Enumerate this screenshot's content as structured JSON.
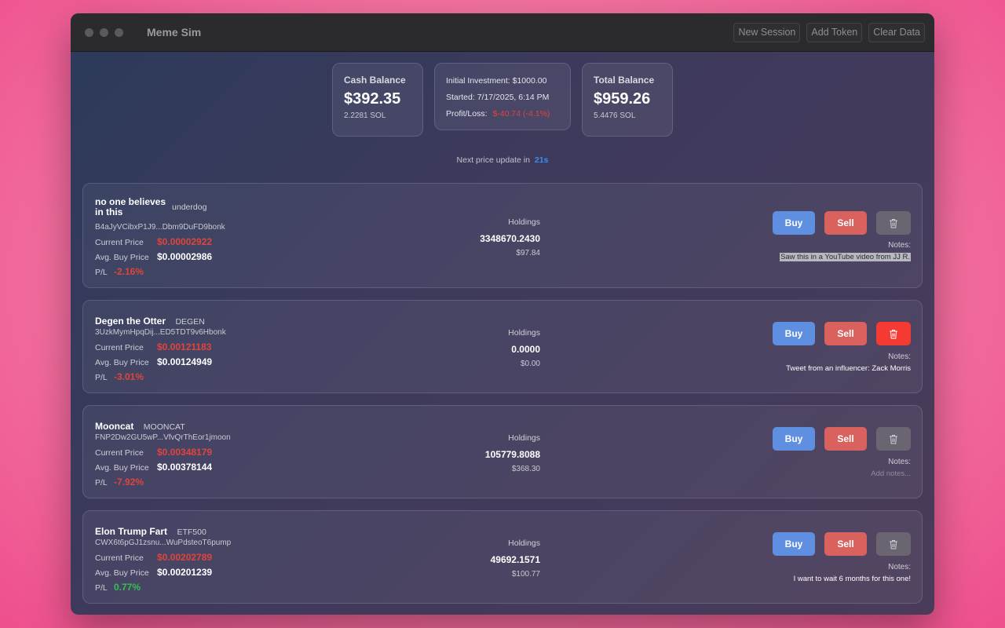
{
  "window": {
    "title": "Meme Sim",
    "toolbar": {
      "new_session": "New Session",
      "add_token": "Add Token",
      "clear_data": "Clear Data"
    }
  },
  "summary": {
    "cash": {
      "label": "Cash Balance",
      "value": "$392.35",
      "sol": "2.2281 SOL"
    },
    "info": {
      "initial_label": "Initial Investment:",
      "initial_value": "$1000.00",
      "started_label": "Started:",
      "started_value": "7/17/2025, 6:14 PM",
      "pl_label": "Profit/Loss:",
      "pl_value": "$-40.74 (-4.1%)"
    },
    "total": {
      "label": "Total Balance",
      "value": "$959.26",
      "sol": "5.4476 SOL"
    }
  },
  "countdown": {
    "label": "Next price update in",
    "value": "21s"
  },
  "labels": {
    "current_price": "Current Price",
    "avg_buy_price": "Avg. Buy Price",
    "pl": "P/L",
    "holdings": "Holdings",
    "notes": "Notes:",
    "buy": "Buy",
    "sell": "Sell"
  },
  "tokens": [
    {
      "name": "no one believes in this",
      "name_line1": "no one believes",
      "name_line2": "in this",
      "symbol": "underdog",
      "address": "B4aJyVCibxP1J9...Dbm9DuFD9bonk",
      "current_price": "$0.00002922",
      "avg_buy_price": "$0.00002986",
      "pl": "-2.16%",
      "holdings_amount": "3348670.2430",
      "holdings_usd": "$97.84",
      "notes": "Saw this in a YouTube video from JJ R."
    },
    {
      "name": "Degen the Otter",
      "symbol": "DEGEN",
      "address": "3UzkMymHpqDij...ED5TDT9v6Hbonk",
      "current_price": "$0.00121183",
      "avg_buy_price": "$0.00124949",
      "pl": "-3.01%",
      "holdings_amount": "0.0000",
      "holdings_usd": "$0.00",
      "notes": "Tweet from an influencer: Zack Morris"
    },
    {
      "name": "Mooncat",
      "symbol": "MOONCAT",
      "address": "FNP2Dw2GU5wP...VfvQrThEor1jmoon",
      "current_price": "$0.00348179",
      "avg_buy_price": "$0.00378144",
      "pl": "-7.92%",
      "holdings_amount": "105779.8088",
      "holdings_usd": "$368.30",
      "notes_placeholder": "Add notes..."
    },
    {
      "name": "Elon Trump Fart",
      "symbol": "ETF500",
      "address": "CWX6t6pGJ1zsnu...WuPdsteoT6pump",
      "current_price": "$0.00202789",
      "avg_buy_price": "$0.00201239",
      "pl": "0.77%",
      "holdings_amount": "49692.1571",
      "holdings_usd": "$100.77",
      "notes": "I want to wait 6 months for this one!"
    }
  ],
  "colors": {
    "negative": "#e0443c",
    "positive": "#35c151",
    "buy": "#5f8fe0",
    "sell": "#d9625e",
    "delete_active": "#f43a32",
    "countdown": "#3b8cf2"
  }
}
